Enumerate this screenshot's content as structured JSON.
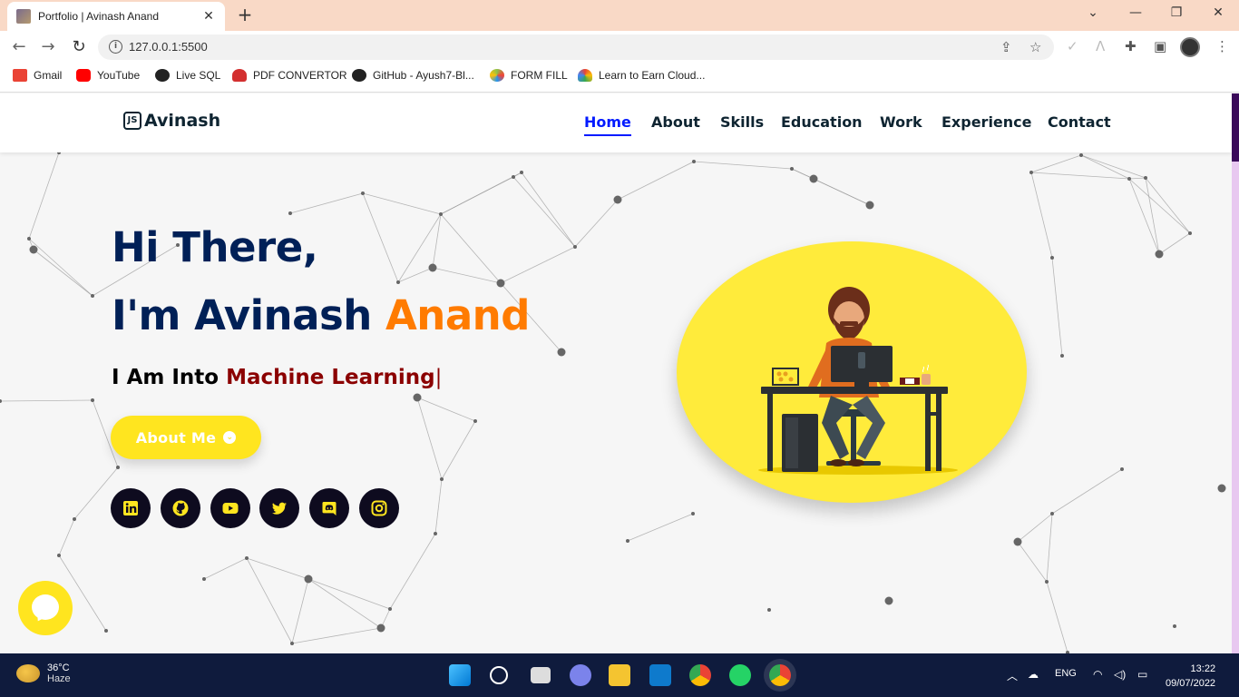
{
  "browser": {
    "tab_title": "Portfolio | Avinash Anand",
    "url": "127.0.0.1:5500",
    "bookmarks": [
      {
        "label": "Gmail",
        "color": "#ea4335"
      },
      {
        "label": "YouTube",
        "color": "#ff0000"
      },
      {
        "label": "Live SQL",
        "color": "#222222"
      },
      {
        "label": "PDF CONVERTOR",
        "color": "#d32f2f"
      },
      {
        "label": "GitHub - Ayush7-Bl...",
        "color": "#222222"
      },
      {
        "label": "FORM FILL",
        "color": "#8bc34a"
      },
      {
        "label": "Learn to Earn Cloud...",
        "color": "#4285f4"
      }
    ]
  },
  "site": {
    "logo_mark": "JS",
    "logo_text": "Avinash",
    "nav": [
      "Home",
      "About",
      "Skills",
      "Education",
      "Work",
      "Experience",
      "Contact"
    ],
    "active_nav": "Home",
    "greeting": "Hi There,",
    "name_prefix": "I'm Avinash ",
    "name_accent": "Anand",
    "into_prefix": "I Am Into ",
    "into_typed": "Machine Learning",
    "into_caret": "|",
    "about_button": "About Me",
    "socials": [
      "linkedin-icon",
      "github-icon",
      "youtube-icon",
      "twitter-icon",
      "discord-icon",
      "instagram-icon"
    ],
    "colors": {
      "navy": "#002057",
      "accent": "#ff7b00",
      "yellow": "#ffe51f",
      "active": "#011aff",
      "typed": "#8b0000"
    }
  },
  "taskbar": {
    "temperature": "36°C",
    "weather": "Haze",
    "language": "ENG",
    "time": "13:22",
    "date": "09/07/2022"
  }
}
